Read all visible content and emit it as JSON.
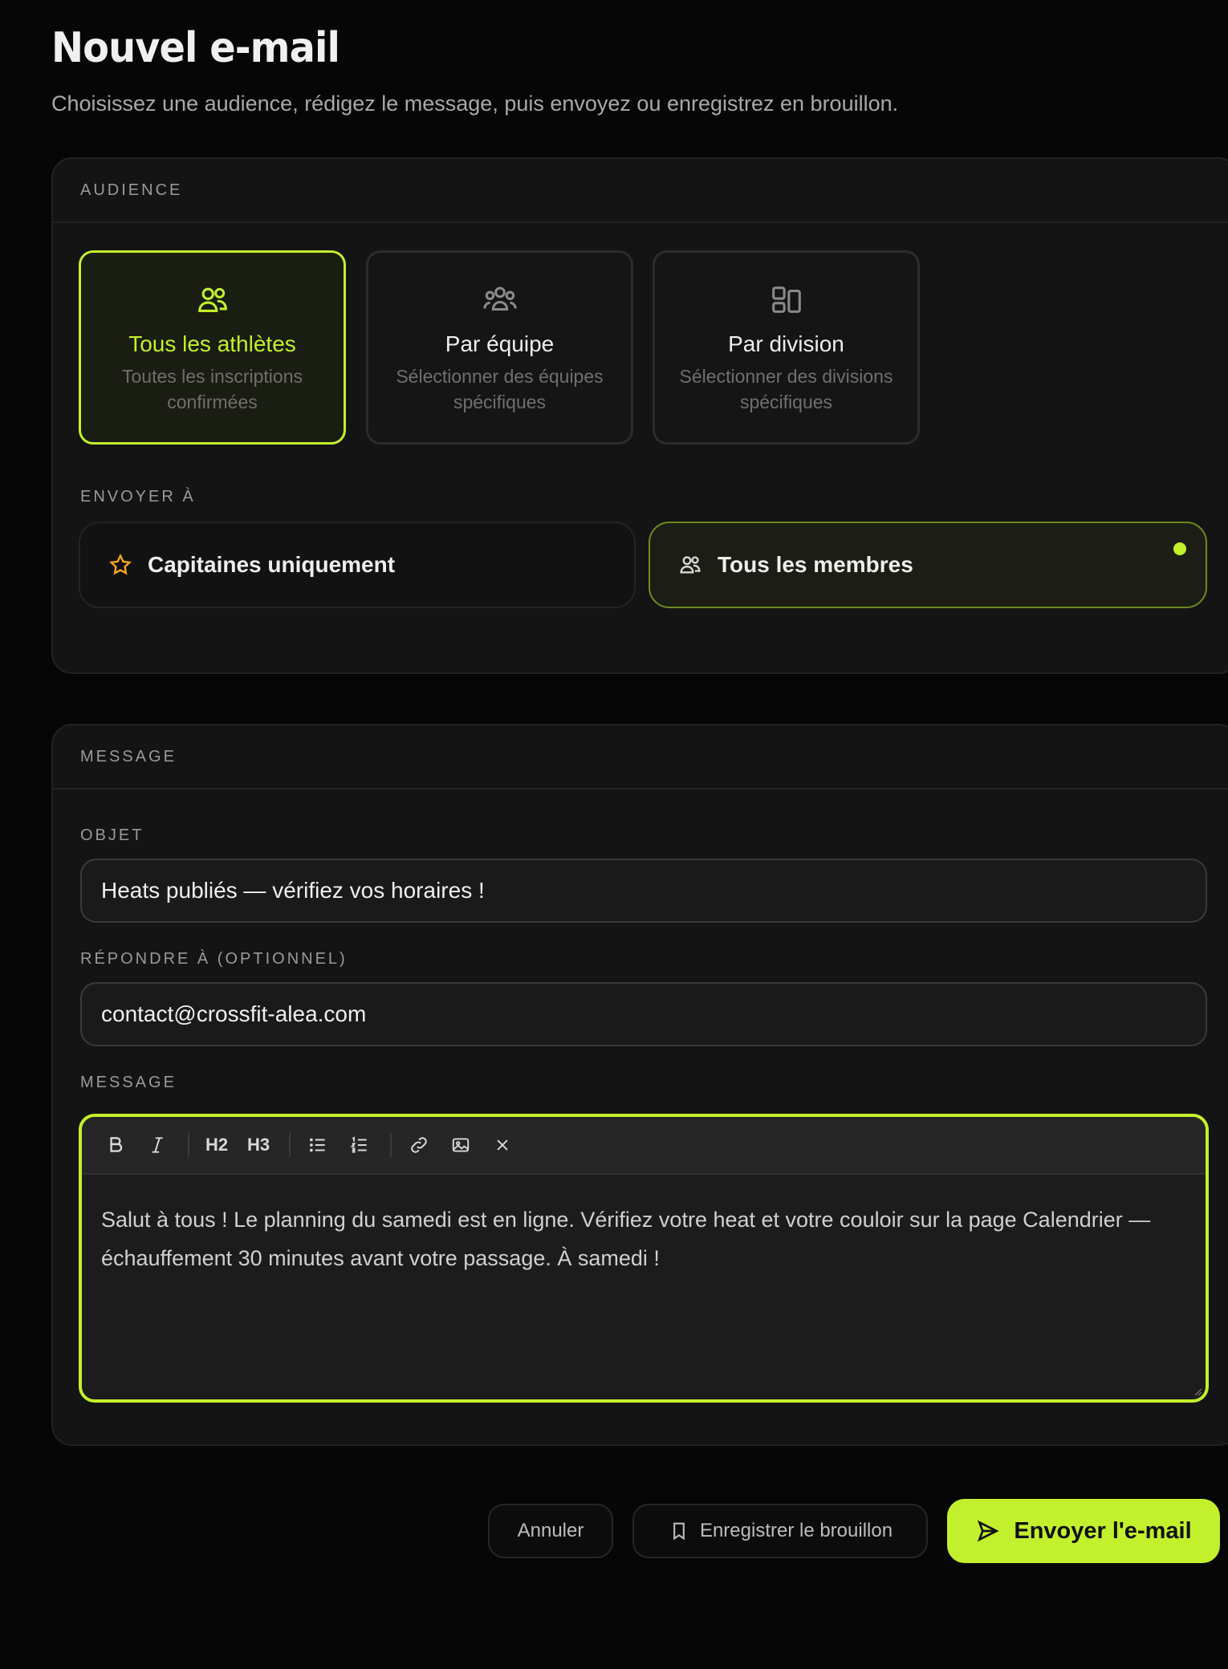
{
  "page": {
    "title": "Nouvel e-mail",
    "subtitle": "Choisissez une audience, rédigez le message, puis envoyez ou enregistrez en brouillon."
  },
  "audience": {
    "header": "AUDIENCE",
    "options": [
      {
        "title": "Tous les athlètes",
        "description": "Toutes les inscriptions confirmées",
        "icon": "users-icon",
        "selected": true
      },
      {
        "title": "Par équipe",
        "description": "Sélectionner des équipes spécifiques",
        "icon": "team-icon",
        "selected": false
      },
      {
        "title": "Par division",
        "description": "Sélectionner des divisions spécifiques",
        "icon": "layout-icon",
        "selected": false
      }
    ],
    "send_to_label": "ENVOYER À",
    "send_to": [
      {
        "label": "Capitaines uniquement",
        "icon": "star-icon",
        "selected": false
      },
      {
        "label": "Tous les membres",
        "icon": "users-icon",
        "selected": true
      }
    ]
  },
  "message": {
    "header": "MESSAGE",
    "subject_label": "OBJET",
    "subject_value": "Heats publiés — vérifiez vos horaires !",
    "reply_to_label": "RÉPONDRE À (OPTIONNEL)",
    "reply_to_value": "contact@crossfit-alea.com",
    "body_label": "MESSAGE",
    "toolbar": {
      "h2": "H2",
      "h3": "H3"
    },
    "body": "Salut à tous ! Le planning du samedi est en ligne. Vérifiez votre heat et votre couloir sur la page Calendrier — échauffement 30 minutes avant votre passage. À samedi !"
  },
  "actions": {
    "cancel": "Annuler",
    "save_draft": "Enregistrer le brouillon",
    "send": "Envoyer l'e-mail"
  },
  "colors": {
    "accent": "#c2f02c",
    "star": "#f5a623",
    "background": "#060606",
    "card": "#141414"
  }
}
